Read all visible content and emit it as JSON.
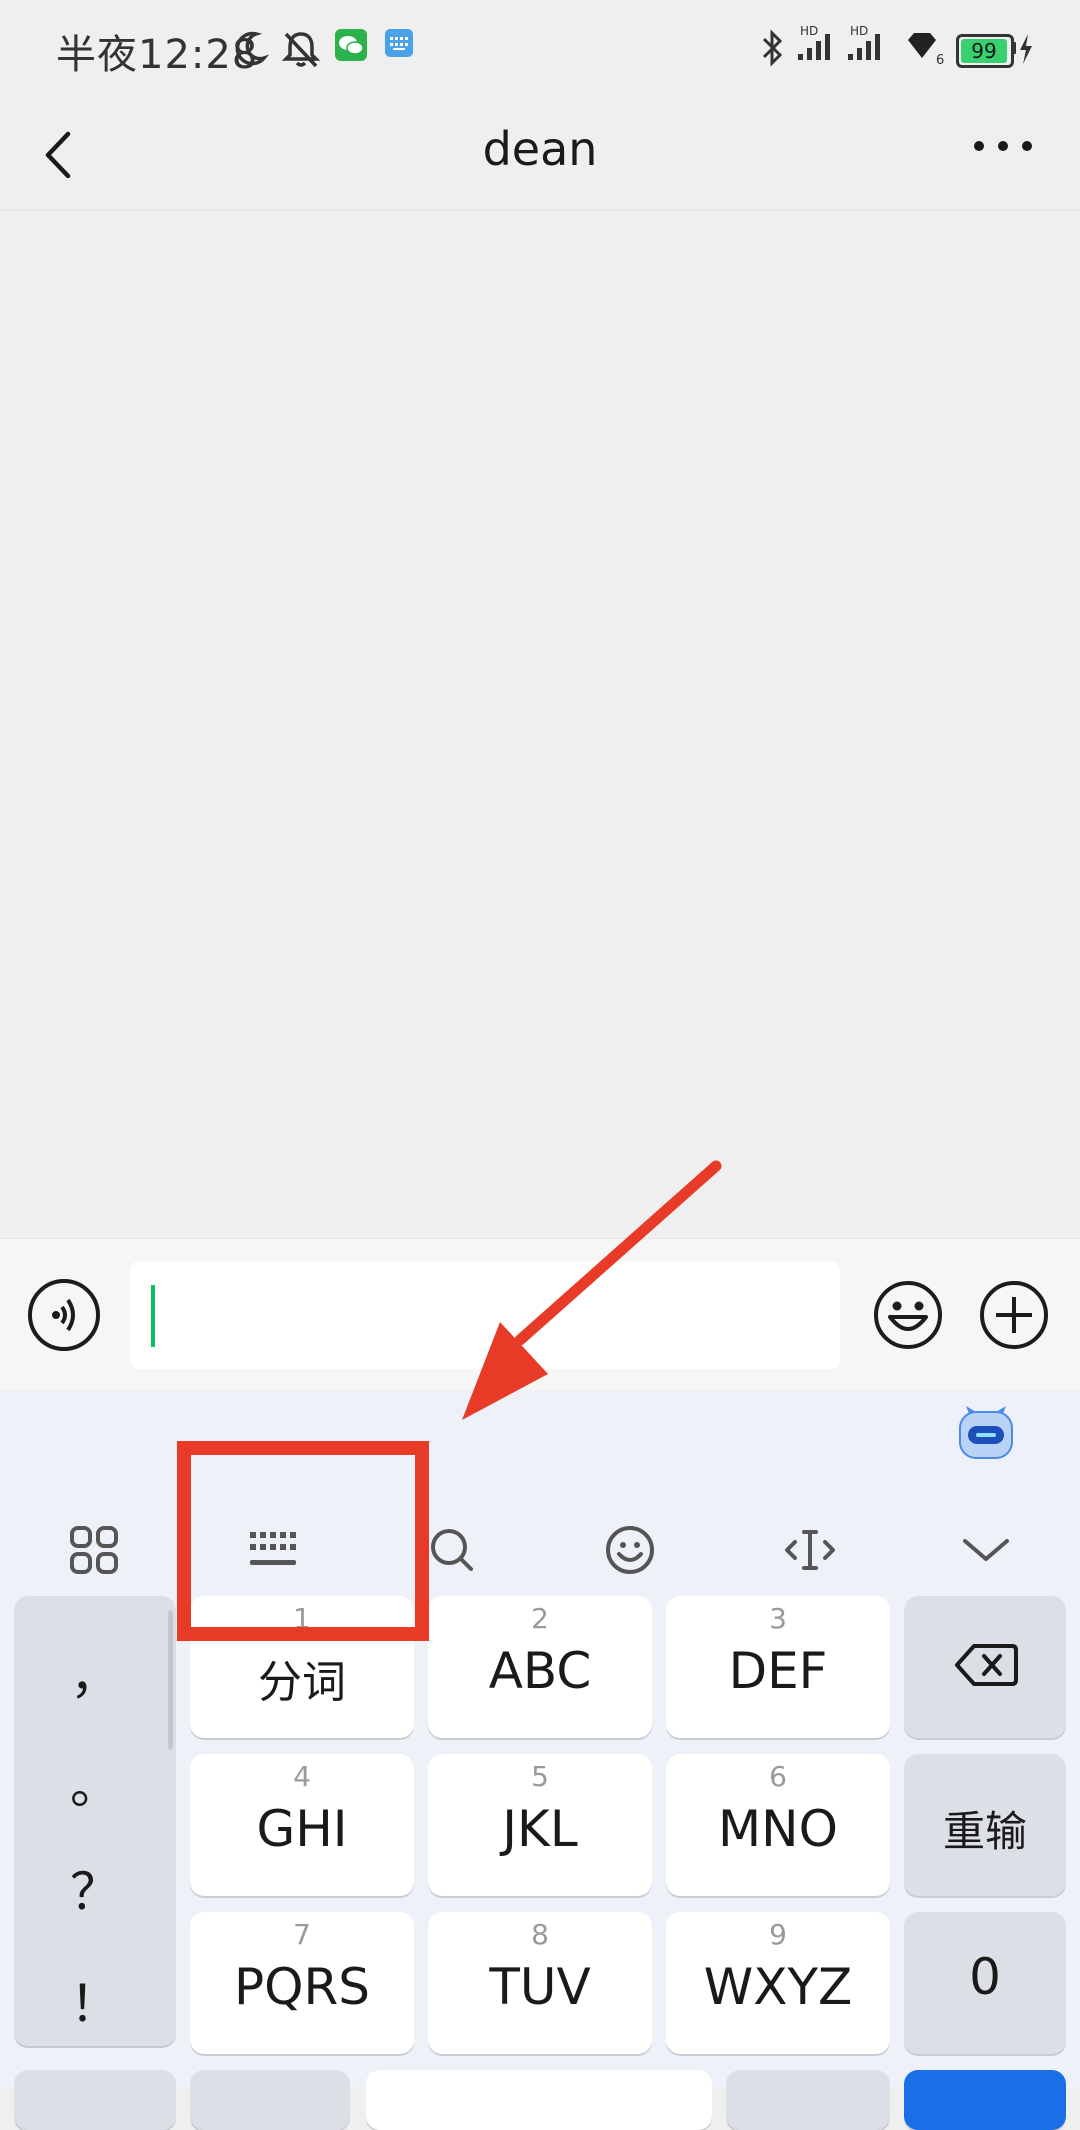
{
  "status_bar": {
    "time": "半夜12:28",
    "battery": "99",
    "signal_labels": [
      "HD",
      "HD"
    ],
    "hotspot_count": "6",
    "icons": [
      "moon-icon",
      "bell-muted-icon",
      "wechat-icon",
      "keyboard-app-icon",
      "bluetooth-icon",
      "signal-icon",
      "signal-icon",
      "hotspot-icon",
      "battery-icon",
      "charging-icon"
    ]
  },
  "header": {
    "title": "dean",
    "back_icon": "chevron-left-icon",
    "more_icon": "more-dots-icon"
  },
  "input_bar": {
    "value": "",
    "voice_icon": "voice-icon",
    "emoji_icon": "emoji-icon",
    "plus_icon": "plus-icon"
  },
  "keyboard": {
    "toolbar_icons": [
      "grid-icon",
      "keyboard-layout-icon",
      "search-icon",
      "emoji-icon",
      "cursor-move-icon",
      "collapse-chevron-icon"
    ],
    "punctuation": [
      "，",
      "。",
      "？",
      "！"
    ],
    "keys": [
      {
        "num": "1",
        "label": "分词"
      },
      {
        "num": "2",
        "label": "ABC"
      },
      {
        "num": "3",
        "label": "DEF"
      },
      {
        "num": "4",
        "label": "GHI"
      },
      {
        "num": "5",
        "label": "JKL"
      },
      {
        "num": "6",
        "label": "MNO"
      },
      {
        "num": "7",
        "label": "PQRS"
      },
      {
        "num": "8",
        "label": "TUV"
      },
      {
        "num": "9",
        "label": "WXYZ"
      }
    ],
    "reenter_label": "重输",
    "zero_label": "0",
    "backspace_icon": "backspace-icon",
    "assistant_icon": "robot-assistant-icon"
  },
  "annotation": {
    "color": "#e83b27"
  },
  "colors": {
    "accent": "#07c160",
    "annotation_red": "#e83b27",
    "keyboard_bg": "#eef1f7"
  }
}
